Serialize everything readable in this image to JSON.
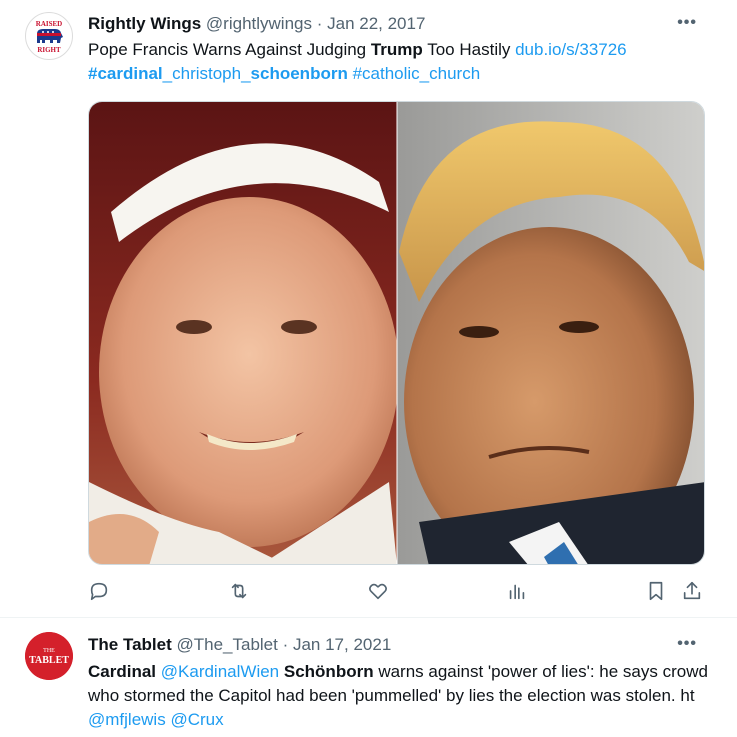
{
  "tweets": [
    {
      "name": "Rightly Wings",
      "handle": "@rightlywings",
      "date": "Jan 22, 2017",
      "avatar_text_top": "RAISED",
      "avatar_text_bottom": "RIGHT",
      "text": {
        "t1": "Pope Francis Warns Against Judging ",
        "t2": "Trump",
        "t3": " Too Hastily ",
        "link": "dub.io/s/33726",
        "tag1_bold": "#cardinal",
        "tag1_rest": "_christoph_",
        "tag1_bold2": "schoenborn",
        "tag2": "#catholic_church"
      }
    },
    {
      "name": "The Tablet",
      "handle": "@The_Tablet",
      "date": "Jan 17, 2021",
      "avatar_line1": "THE",
      "avatar_line2": "TABLET",
      "text": {
        "t1": "Cardinal",
        "m1": "@KardinalWien",
        "t2": "Schönborn",
        "t3": " warns against 'power of lies': he says crowd who stormed the Capitol had been 'pummelled' by lies the election was stolen. ht ",
        "m2": "@mfjlewis",
        "m3": "@Crux"
      }
    }
  ],
  "separator": " · ",
  "more_label": "•••",
  "actions": [
    "reply-icon",
    "retweet-icon",
    "like-icon",
    "views-icon",
    "bookmark-icon",
    "share-icon"
  ],
  "colors": {
    "link": "#1d9bf0",
    "muted": "#536471",
    "tablet_red": "#d4202b",
    "gop_red": "#c8102e",
    "gop_blue": "#1b3a8c"
  }
}
